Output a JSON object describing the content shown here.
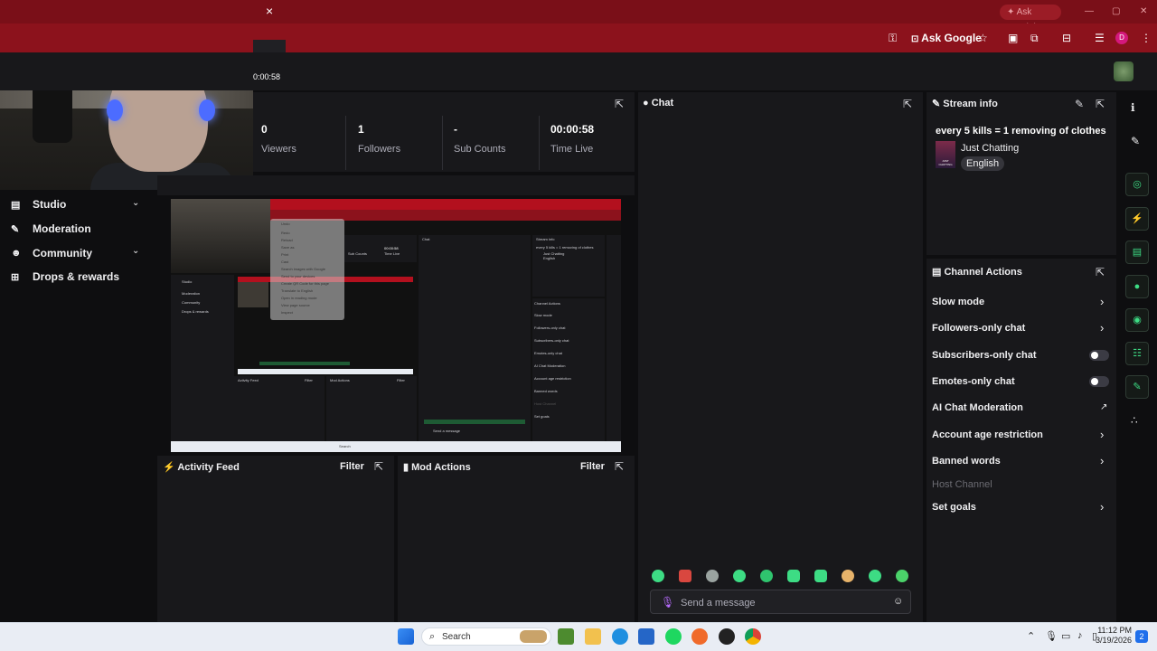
{
  "browser": {
    "close_tab": "×",
    "ask_gemini": "Ask Gemini",
    "ask_google": "Ask Google",
    "profile_initial": "D",
    "time_fragment": "0:00:58"
  },
  "stats": [
    {
      "value": "0",
      "label": "Viewers"
    },
    {
      "value": "1",
      "label": "Followers"
    },
    {
      "value": "-",
      "label": "Sub Counts"
    },
    {
      "value": "00:00:58",
      "label": "Time Live"
    }
  ],
  "sidebar": {
    "items": [
      {
        "label": "Studio",
        "icon": "studio-icon",
        "has_chevron": true
      },
      {
        "label": "Moderation",
        "icon": "wrench-icon",
        "has_chevron": false
      },
      {
        "label": "Community",
        "icon": "community-icon",
        "has_chevron": true
      },
      {
        "label": "Drops & rewards",
        "icon": "rewards-icon",
        "has_chevron": false
      }
    ]
  },
  "panels": {
    "activity_feed": {
      "title": "Activity Feed",
      "filter": "Filter"
    },
    "mod_actions": {
      "title": "Mod Actions",
      "filter": "Filter"
    },
    "chat": {
      "title": "Chat",
      "placeholder": "Send a message"
    },
    "stream_info": {
      "title": "Stream info",
      "stream_title": "every 5 kills = 1 removing of clothes",
      "category": "Just Chatting",
      "category_box": "JUST CHATTING",
      "language": "English"
    },
    "channel_actions": {
      "title": "Channel Actions",
      "rows": [
        {
          "label": "Slow mode",
          "control": "chevron"
        },
        {
          "label": "Followers-only chat",
          "control": "chevron"
        },
        {
          "label": "Subscribers-only chat",
          "control": "toggle",
          "on": false
        },
        {
          "label": "Emotes-only chat",
          "control": "toggle",
          "on": false
        },
        {
          "label": "AI Chat Moderation",
          "control": "external"
        },
        {
          "label": "Account age restriction",
          "control": "chevron"
        },
        {
          "label": "Banned words",
          "control": "chevron"
        },
        {
          "label": "Host Channel",
          "control": "disabled"
        },
        {
          "label": "Set goals",
          "control": "chevron"
        }
      ]
    }
  },
  "preview": {
    "menu_items": [
      "Undo",
      "Redo",
      "Reload",
      "Save as",
      "Print",
      "Cast",
      "Search images with Google",
      "Send to your devices",
      "Create QR Code for this page",
      "Translate to English",
      "Open in reading mode",
      "View page source",
      "Inspect"
    ],
    "stream_info_title": "every 5 kills = 1 removing of clothes",
    "stream_category": "Just Chatting",
    "stream_language": "English",
    "time_live": "00:00:58",
    "time_live_label": "Time Live",
    "sub_counts_label": "Sub Counts",
    "sidebar": [
      "Studio",
      "Moderation",
      "Community",
      "Drops & rewards"
    ],
    "actions": [
      "Slow mode",
      "Followers-only chat",
      "Subscribers-only chat",
      "Emotes-only chat",
      "AI Chat Moderation",
      "Account age restriction",
      "Banned words",
      "Host Channel",
      "Set goals"
    ],
    "chat_title": "Chat",
    "stream_info_label": "Stream info",
    "channel_actions_label": "Channel Actions",
    "activity_feed_label": "Activity Feed",
    "mod_actions_label": "Mod Actions",
    "filter": "Filter",
    "send_placeholder": "Send a message",
    "taskbar_search": "Search"
  },
  "taskbar": {
    "search": "Search",
    "time": "11:12 PM",
    "date": "3/19/2026",
    "notifications": "2"
  },
  "colors": {
    "browser_frame": "#7a0f18",
    "panel_bg": "#18181b",
    "page_bg": "#0e0e10",
    "accent_green": "#3ddc84"
  }
}
